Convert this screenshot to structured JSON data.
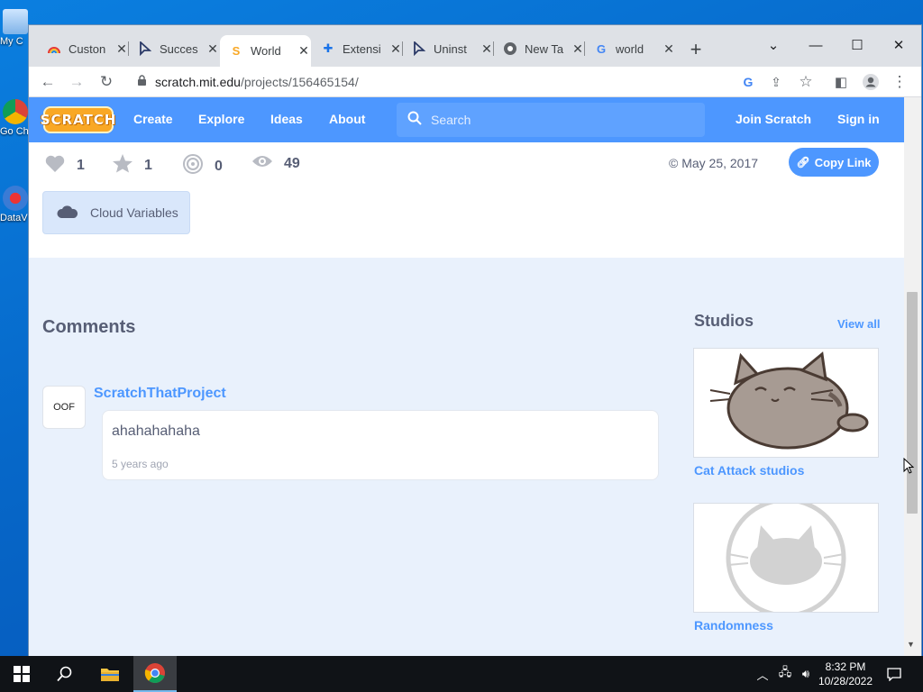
{
  "desktop": {
    "icons": [
      {
        "label": "My C"
      },
      {
        "label": "Go Ch"
      },
      {
        "label": "DataV"
      }
    ]
  },
  "browser": {
    "tabs": [
      {
        "label": "Custon",
        "icon": "rainbow-icon"
      },
      {
        "label": "Succes",
        "icon": "cursor-arrow-icon"
      },
      {
        "label": "World",
        "icon": "scratch-s-icon",
        "active": true
      },
      {
        "label": "Extensi",
        "icon": "puzzle-icon"
      },
      {
        "label": "Uninst",
        "icon": "cursor-arrow-icon"
      },
      {
        "label": "New Ta",
        "icon": "chrome-icon"
      },
      {
        "label": "world",
        "icon": "google-g-icon"
      }
    ],
    "new_tab": "+",
    "window_controls": {
      "dropdown": "⌄",
      "minimize": "—",
      "maximize": "☐",
      "close": "✕"
    },
    "url": {
      "host": "scratch.mit.edu",
      "path": "/projects/156465154/"
    }
  },
  "scratch": {
    "logo": "SCRATCH",
    "nav": {
      "create": "Create",
      "explore": "Explore",
      "ideas": "Ideas",
      "about": "About",
      "join": "Join Scratch",
      "signin": "Sign in"
    },
    "search_placeholder": "Search",
    "stats": {
      "loves": "1",
      "favorites": "1",
      "remixes": "0",
      "views": "49"
    },
    "shared_date": "© May 25, 2017",
    "copy_link": "Copy Link",
    "cloud_tag": "Cloud Variables",
    "comments": {
      "title": "Comments",
      "items": [
        {
          "avatar_text": "OOF",
          "author": "ScratchThatProject",
          "text": "ahahahahaha",
          "time": "5 years ago"
        }
      ]
    },
    "studios": {
      "title": "Studios",
      "view_all": "View all",
      "items": [
        {
          "name": "Cat Attack studios"
        },
        {
          "name": "Randomness"
        }
      ]
    }
  },
  "taskbar": {
    "time": "8:32 PM",
    "date": "10/28/2022"
  },
  "colors": {
    "scratch_blue": "#4d97ff",
    "text_gray": "#575e75",
    "page_bg": "#e9f1fc"
  }
}
